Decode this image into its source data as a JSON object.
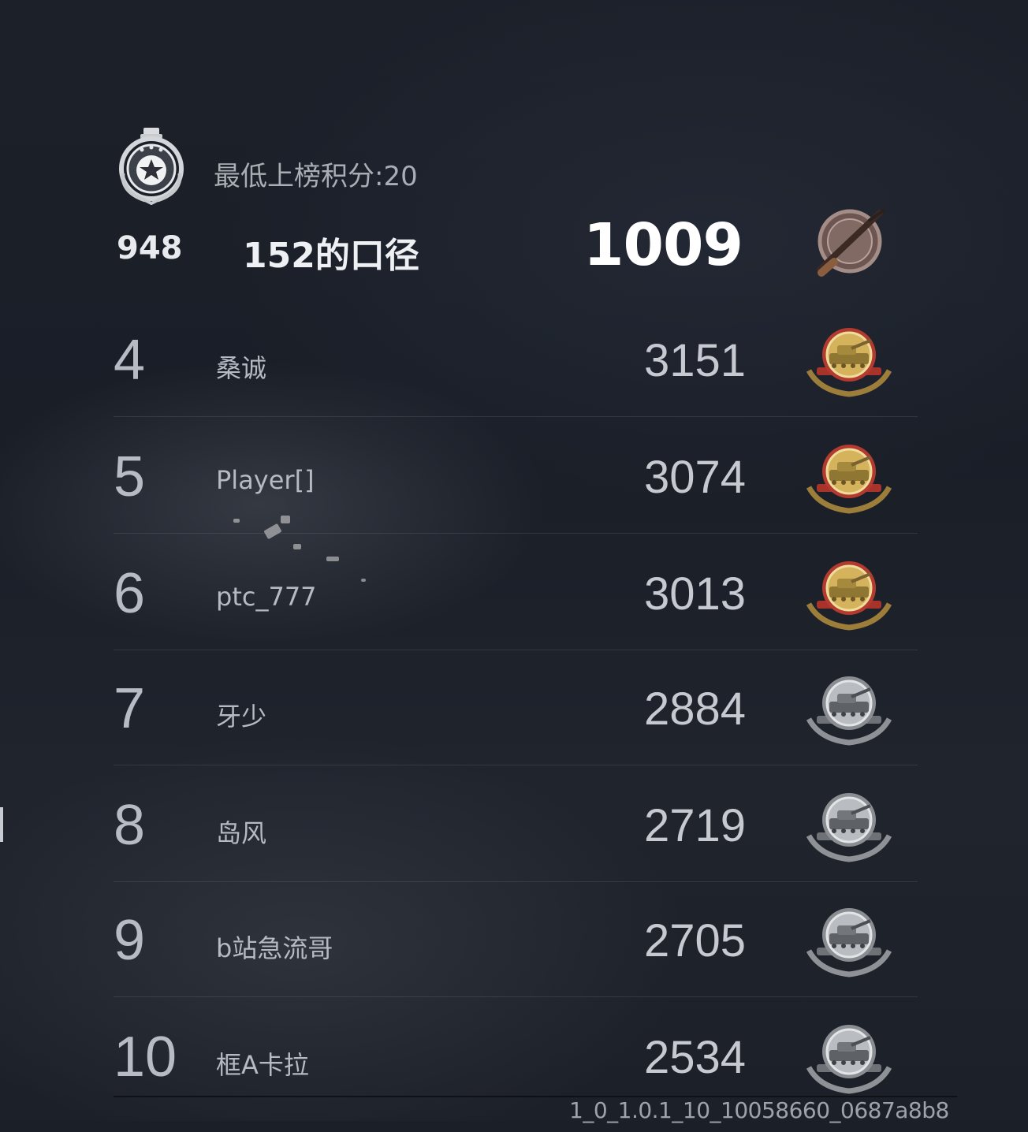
{
  "header": {
    "min_score_label": "最低上榜积分:20",
    "emblem_icon": "star-rank-emblem"
  },
  "self": {
    "rank": "948",
    "name": "152的口径",
    "score": "1009",
    "badge_icon": "rifle-bronze-medal"
  },
  "leaderboard": [
    {
      "rank": "4",
      "name": "桑诚",
      "score": "3151",
      "badge_icon": "gold-tank-medal"
    },
    {
      "rank": "5",
      "name": "Player[]",
      "score": "3074",
      "badge_icon": "gold-tank-medal"
    },
    {
      "rank": "6",
      "name": "ptc_777",
      "score": "3013",
      "badge_icon": "gold-tank-medal"
    },
    {
      "rank": "7",
      "name": "牙少",
      "score": "2884",
      "badge_icon": "silver-tank-medal"
    },
    {
      "rank": "8",
      "name": "岛风",
      "score": "2719",
      "badge_icon": "silver-tank-medal"
    },
    {
      "rank": "9",
      "name": "b站急流哥",
      "score": "2705",
      "badge_icon": "silver-tank-medal"
    },
    {
      "rank": "10",
      "name": "框A卡拉",
      "score": "2534",
      "badge_icon": "silver-tank-medal"
    }
  ],
  "footer": {
    "version": "1_0_1.0.1_10_10058660_0687a8b8"
  },
  "colors": {
    "background": "#1b1f28",
    "gold": "#c9a24a",
    "red": "#b8372c",
    "silver": "#b9bcc1",
    "bronze": "#8a6f66"
  }
}
